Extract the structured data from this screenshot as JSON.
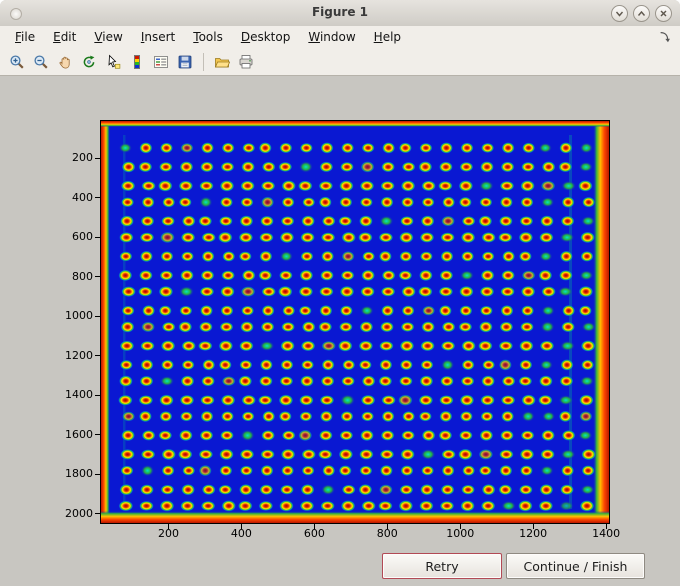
{
  "window": {
    "title": "Figure 1"
  },
  "titlebar": {
    "buttons": [
      {
        "name": "minimize",
        "glyph": "chevron-down"
      },
      {
        "name": "maximize",
        "glyph": "chevron-up"
      },
      {
        "name": "close",
        "glyph": "x"
      }
    ]
  },
  "menubar": {
    "items": [
      "File",
      "Edit",
      "View",
      "Insert",
      "Tools",
      "Desktop",
      "Window",
      "Help"
    ]
  },
  "toolbar": {
    "icons": [
      "zoom-in",
      "zoom-out",
      "pan",
      "rotate-3d",
      "data-cursor",
      "colorbar",
      "legend",
      "save",
      "open",
      "print"
    ]
  },
  "figure": {
    "axes": {
      "x_ticks": [
        200,
        400,
        600,
        800,
        1000,
        1200,
        1400
      ],
      "y_ticks": [
        200,
        400,
        600,
        800,
        1000,
        1200,
        1400,
        1600,
        1800,
        2000
      ]
    },
    "image": {
      "type": "microarray-heatmap",
      "colormap": "jet",
      "background_color": "#0a18d2",
      "grid_rows": 21,
      "grid_cols": 24,
      "spot_core_color": "#a80000",
      "spot_mid_color": "#ff9800",
      "spot_ring_color": "#ffe800",
      "spot_halo_color": "#50c818",
      "spot_alt_color": "#00e8c8",
      "border_edge_color": "#b81800",
      "border_warm_color": "#ff4800",
      "border_yellow_color": "#ffc000",
      "border_green_color": "#38b838"
    }
  },
  "buttons": {
    "retry": "Retry",
    "continue": "Continue / Finish"
  }
}
